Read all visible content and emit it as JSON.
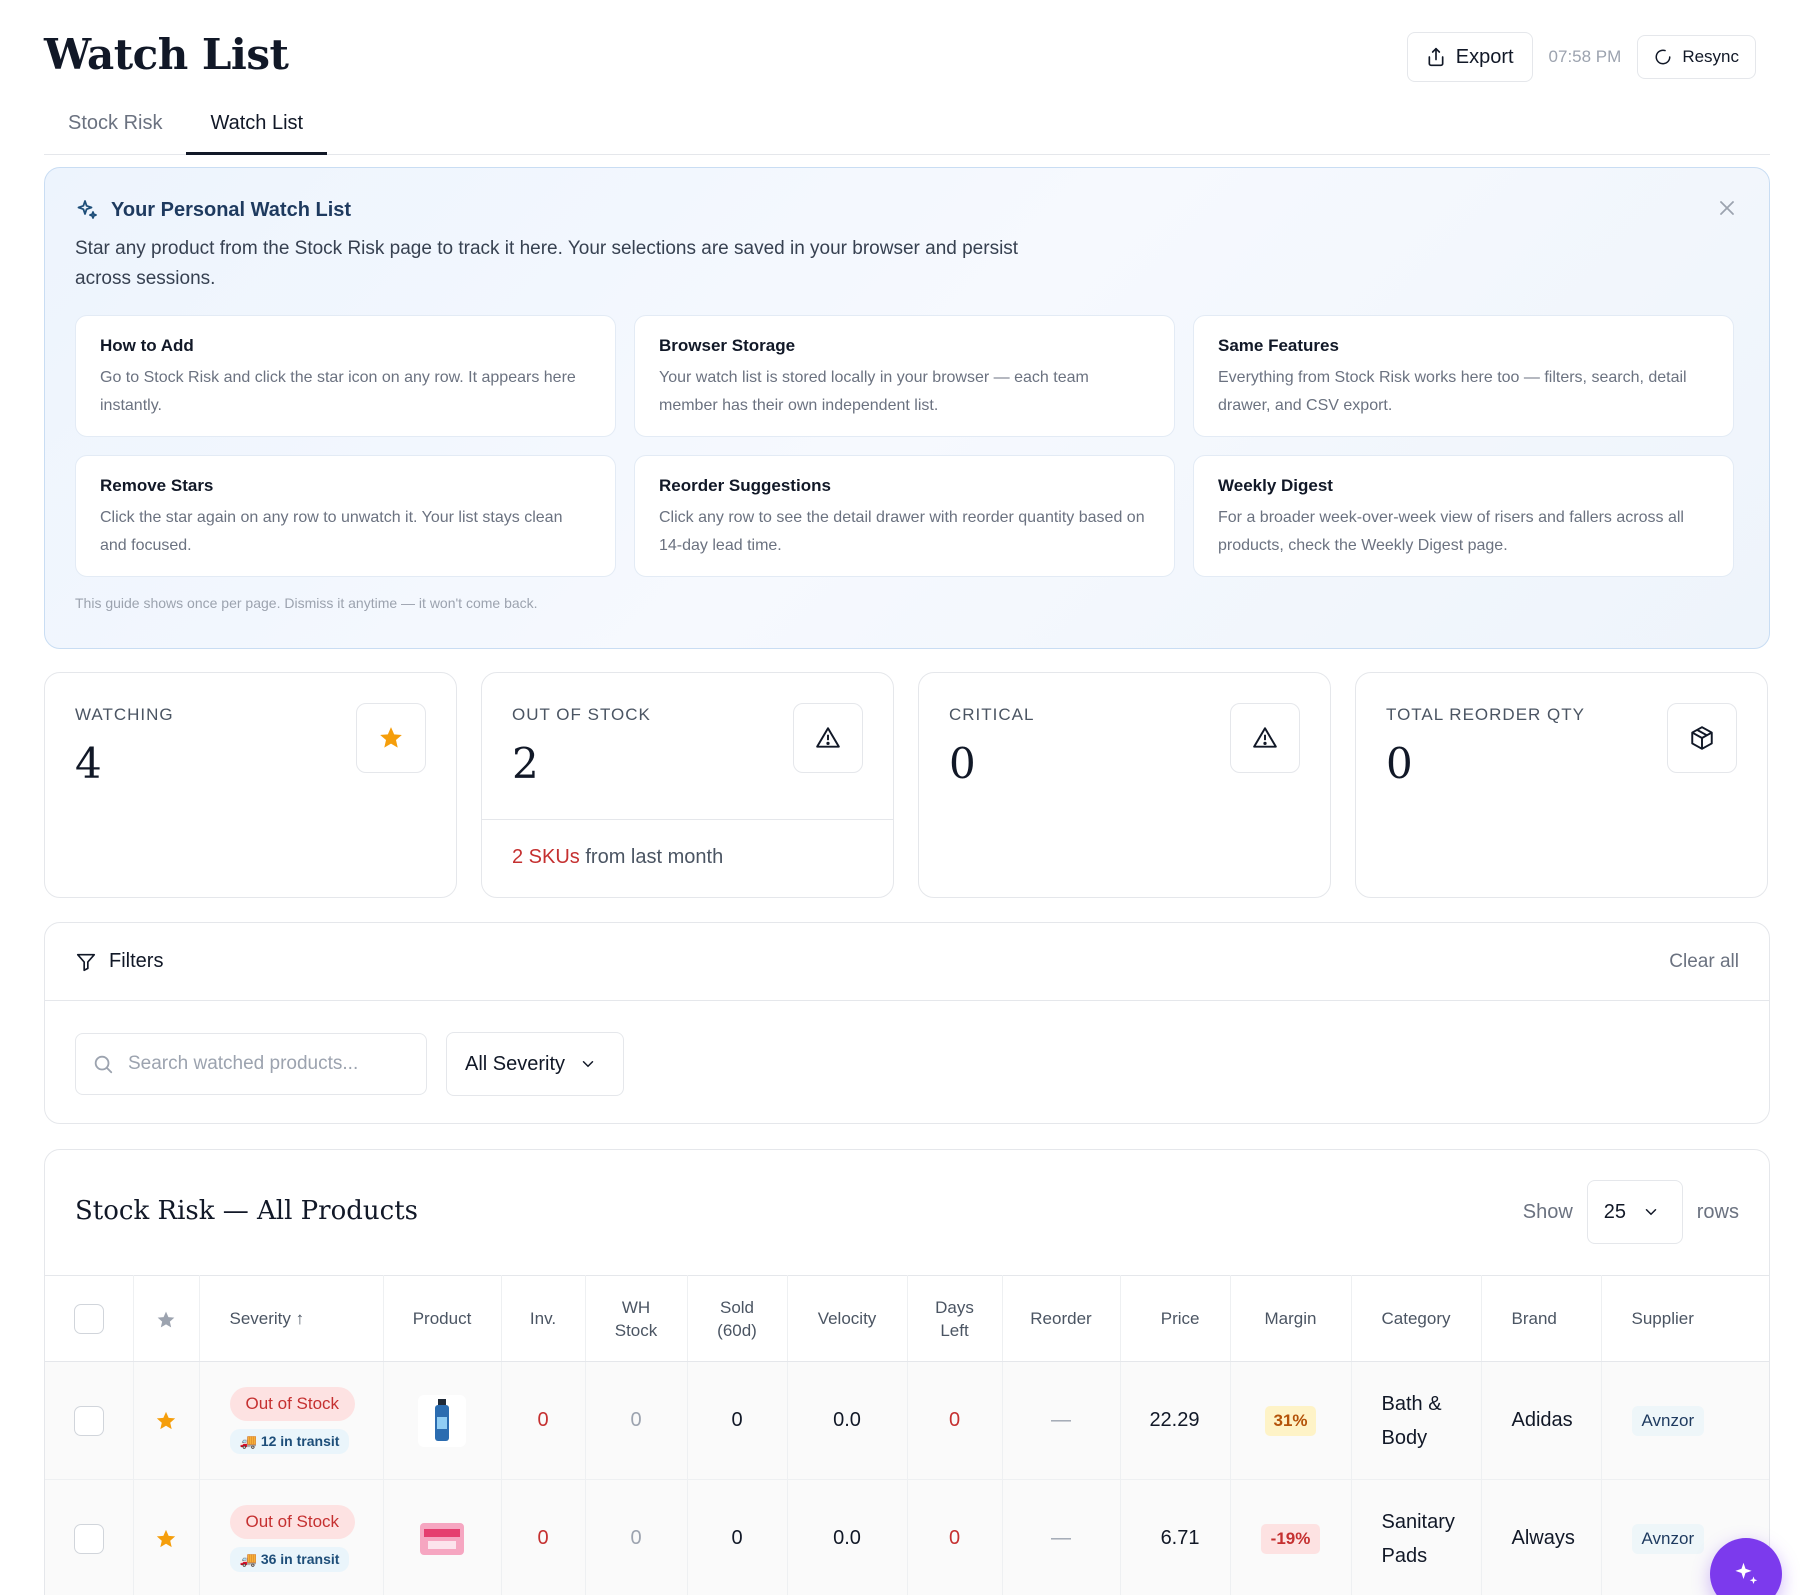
{
  "header": {
    "title": "Watch List",
    "export_label": "Export",
    "time": "07:58 PM",
    "resync_label": "Resync"
  },
  "tabs": [
    {
      "label": "Stock Risk",
      "active": false
    },
    {
      "label": "Watch List",
      "active": true
    }
  ],
  "guide": {
    "title": "Your Personal Watch List",
    "description": "Star any product from the Stock Risk page to track it here. Your selections are saved in your browser and persist across sessions.",
    "cards": [
      {
        "title": "How to Add",
        "text": "Go to Stock Risk and click the star icon on any row. It appears here instantly."
      },
      {
        "title": "Browser Storage",
        "text": "Your watch list is stored locally in your browser — each team member has their own independent list."
      },
      {
        "title": "Same Features",
        "text": "Everything from Stock Risk works here too — filters, search, detail drawer, and CSV export."
      },
      {
        "title": "Remove Stars",
        "text": "Click the star again on any row to unwatch it. Your list stays clean and focused."
      },
      {
        "title": "Reorder Suggestions",
        "text": "Click any row to see the detail drawer with reorder quantity based on 14-day lead time."
      },
      {
        "title": "Weekly Digest",
        "text": "For a broader week-over-week view of risers and fallers across all products, check the Weekly Digest page."
      }
    ],
    "footer": "This guide shows once per page. Dismiss it anytime — it won't come back."
  },
  "stats": [
    {
      "label": "WATCHING",
      "value": "4",
      "icon": "star-icon"
    },
    {
      "label": "OUT OF STOCK",
      "value": "2",
      "icon": "alert-triangle-icon",
      "foot_highlight": "2 SKUs",
      "foot_text": " from last month"
    },
    {
      "label": "CRITICAL",
      "value": "0",
      "icon": "alert-triangle-icon"
    },
    {
      "label": "TOTAL REORDER QTY",
      "value": "0",
      "icon": "package-icon"
    }
  ],
  "filters": {
    "title": "Filters",
    "clear_label": "Clear all",
    "search_placeholder": "Search watched products...",
    "severity_value": "All Severity"
  },
  "table": {
    "title": "Stock Risk — All Products",
    "show_label": "Show",
    "rows_value": "25",
    "rows_label": "rows",
    "columns": {
      "severity": "Severity ↑",
      "product": "Product",
      "inv": "Inv.",
      "wh_stock_1": "WH",
      "wh_stock_2": "Stock",
      "sold_1": "Sold",
      "sold_2": "(60d)",
      "velocity": "Velocity",
      "days_1": "Days",
      "days_2": "Left",
      "reorder": "Reorder",
      "price": "Price",
      "margin": "Margin",
      "category": "Category",
      "brand": "Brand",
      "supplier": "Supplier"
    },
    "rows": [
      {
        "severity": "Out of Stock",
        "transit": "🚚 12 in transit",
        "inv": "0",
        "wh_stock": "0",
        "sold": "0",
        "velocity": "0.0",
        "days_left": "0",
        "reorder": "—",
        "price": "22.29",
        "margin": "31%",
        "category_1": "Bath &",
        "category_2": "Body",
        "brand": "Adidas",
        "supplier": "Avnzor"
      },
      {
        "severity": "Out of Stock",
        "transit": "🚚 36 in transit",
        "inv": "0",
        "wh_stock": "0",
        "sold": "0",
        "velocity": "0.0",
        "days_left": "0",
        "reorder": "—",
        "price": "6.71",
        "margin": "-19%",
        "category_1": "Sanitary",
        "category_2": "Pads",
        "brand": "Always",
        "supplier": "Avnzor"
      }
    ]
  },
  "colors": {
    "accent_purple": "#7c3aed",
    "danger_red": "#c53030",
    "star_orange": "#f59e0b"
  }
}
